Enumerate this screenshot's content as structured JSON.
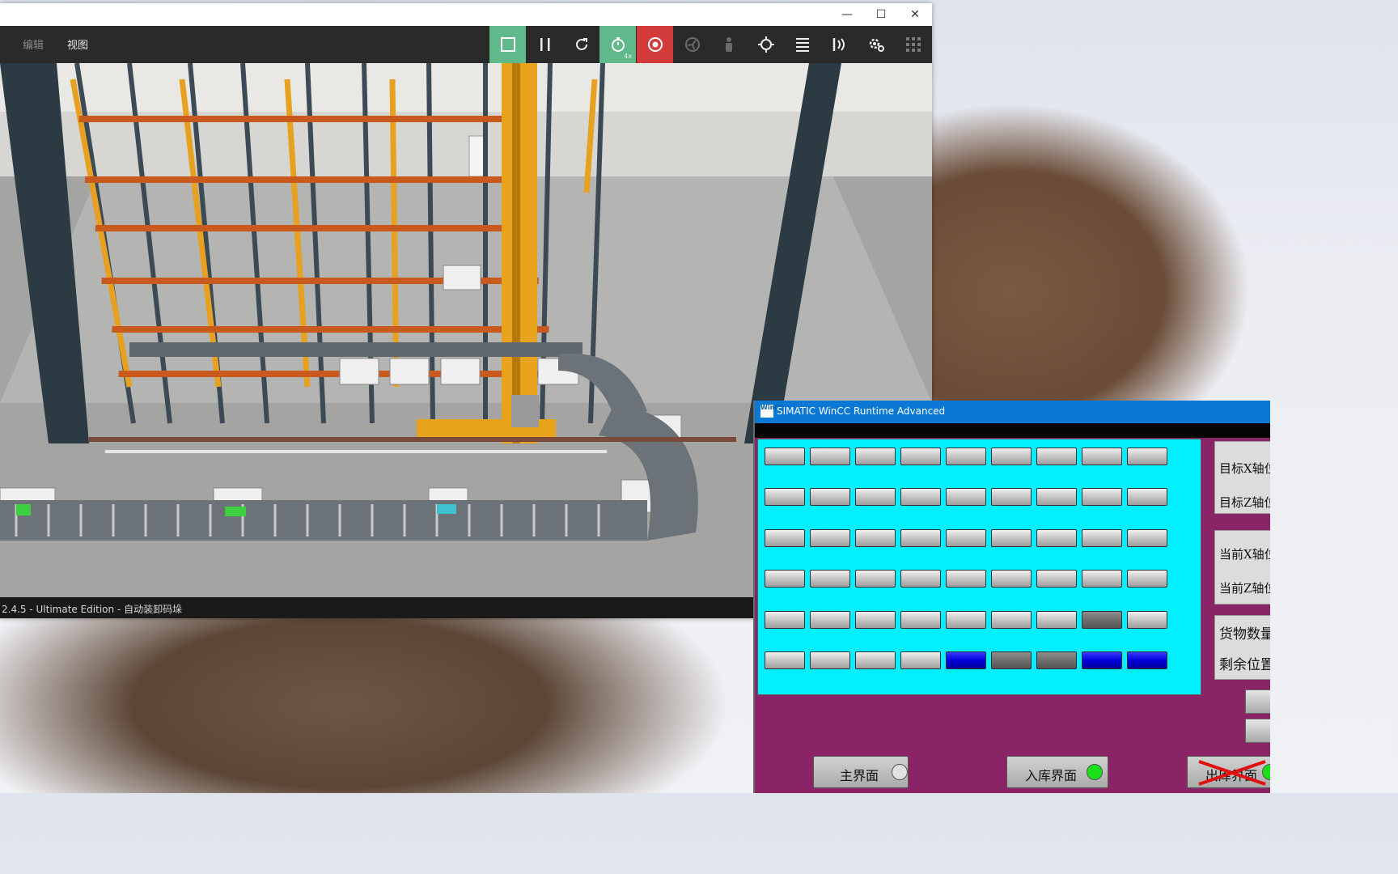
{
  "sim": {
    "menu": {
      "edit": "编辑",
      "view": "视图"
    },
    "toolbar": {
      "speed_badge": "4x",
      "buttons": [
        "stop-icon",
        "pause-icon",
        "reset-icon",
        "speed-timer-icon",
        "record-icon",
        "fan-icon",
        "person-icon",
        "target-icon",
        "list-icon",
        "sensor-icon",
        "settings-icon",
        "grid-icon"
      ],
      "colors": {
        "active": "#5fb98a",
        "record": "#d33a3a",
        "bar": "#2a2a2a"
      }
    },
    "status_text": "2.4.5 - Ultimate Edition - 自动装卸码垛"
  },
  "wincc": {
    "title": "SIMATIC WinCC Runtime Advanced",
    "logo": "WinCC",
    "grid": {
      "rows": 6,
      "cols": 9,
      "states": [
        [
          "g",
          "g",
          "g",
          "g",
          "g",
          "g",
          "g",
          "g",
          "g"
        ],
        [
          "g",
          "g",
          "g",
          "g",
          "g",
          "g",
          "g",
          "g",
          "g"
        ],
        [
          "g",
          "g",
          "g",
          "g",
          "g",
          "g",
          "g",
          "g",
          "g"
        ],
        [
          "g",
          "g",
          "g",
          "g",
          "g",
          "g",
          "g",
          "g",
          "g"
        ],
        [
          "g",
          "g",
          "g",
          "g",
          "g",
          "g",
          "g",
          "d",
          "g"
        ],
        [
          "g",
          "g",
          "g",
          "g",
          "b",
          "d",
          "d",
          "b",
          "b"
        ]
      ],
      "colors": {
        "panel": "#00f0ff",
        "occupied": "#0000d8",
        "frame": "#8b2466"
      }
    },
    "info": {
      "target_x": "目标X轴位",
      "target_z": "目标Z轴位",
      "current_x": "当前X轴位",
      "current_z": "当前Z轴位",
      "cargo_count": "货物数量",
      "remaining": "剩余位置"
    },
    "nav": {
      "main": "主界面",
      "inbound": "入库界面",
      "outbound": "出库界面"
    },
    "indicator_colors": {
      "main": "#e0e0e0",
      "inbound": "#19e019",
      "outbound": "#19e019"
    }
  }
}
